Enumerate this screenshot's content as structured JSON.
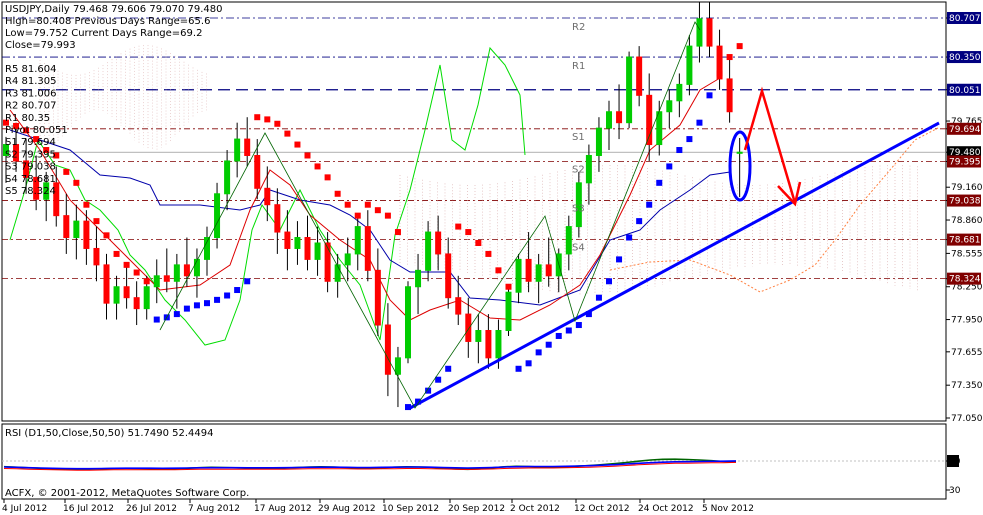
{
  "header": {
    "symbol": "USDJPY,Daily",
    "ohlc": "79.468 79.606 79.070 79.480",
    "lines": [
      "High=80.408   Previous Days Range=65.6",
      "Low=79.752   Current Days Range=69.2",
      "Close=79.993"
    ]
  },
  "pivot_list": [
    "R5 81.604",
    "R4 81.305",
    "R3 81.006",
    "R2 80.707",
    "R1 80.35",
    "Pivot 80.051",
    "S1 79.694",
    "S2 79.395",
    "S3 79.038",
    "S4 78.681",
    "S5 78.324"
  ],
  "level_tags": [
    "R2",
    "R1",
    "S1",
    "S2",
    "S3",
    "S4"
  ],
  "rsi_title": "RSI (D1,50,Close,50,50) 51.7490 52.4494",
  "copyright": "ACFX, © 2001-2012, MetaQuotes Software Corp.",
  "colors": {
    "bull": "#00cc00",
    "bear": "#ff0000",
    "psar": "#0000ff",
    "pivot_line": "#000080",
    "level_line": "#800000",
    "trend": "#0000ff",
    "ichimoku_span": "#ff8040",
    "kumo": "#d8a8a8",
    "green_line": "#00dd00",
    "rsi": "#006400",
    "rsi_ma": "#0000ff",
    "rsi_red": "#ff0000"
  },
  "chart_data": [
    {
      "type": "candlestick",
      "title": "USDJPY,Daily",
      "x_ticks": [
        "4 Jul 2012",
        "16 Jul 2012",
        "26 Jul 2012",
        "7 Aug 2012",
        "17 Aug 2012",
        "29 Aug 2012",
        "10 Sep 2012",
        "20 Sep 2012",
        "2 Oct 2012",
        "12 Oct 2012",
        "24 Oct 2012",
        "5 Nov 2012"
      ],
      "y_ticks": [
        80.707,
        80.35,
        80.051,
        79.765,
        79.694,
        79.48,
        79.395,
        79.16,
        79.038,
        78.86,
        78.681,
        78.555,
        78.324,
        78.25,
        77.95,
        77.655,
        77.35,
        77.05
      ],
      "ylim": [
        77.05,
        80.9
      ],
      "price_labels": [
        {
          "text": "80.707",
          "color": "#000080"
        },
        {
          "text": "80.350",
          "color": "#000080"
        },
        {
          "text": "80.051",
          "color": "#000080"
        },
        {
          "text": "79.694",
          "color": "#800000"
        },
        {
          "text": "79.480",
          "color": "#000000"
        },
        {
          "text": "79.395",
          "color": "#800000"
        },
        {
          "text": "79.038",
          "color": "#800000"
        },
        {
          "text": "78.681",
          "color": "#800000"
        },
        {
          "text": "78.324",
          "color": "#800000"
        }
      ],
      "pivot_levels": [
        {
          "name": "R2",
          "value": 80.707
        },
        {
          "name": "R1",
          "value": 80.35
        },
        {
          "name": "Pivot",
          "value": 80.051
        },
        {
          "name": "S1",
          "value": 79.694
        },
        {
          "name": "S2",
          "value": 79.395
        },
        {
          "name": "S3",
          "value": 79.038
        },
        {
          "name": "S4",
          "value": 78.681
        },
        {
          "name": "S5",
          "value": 78.324
        }
      ],
      "candles": [
        [
          79.45,
          79.62,
          79.2,
          79.55
        ],
        [
          79.55,
          79.75,
          79.3,
          79.4
        ],
        [
          79.4,
          79.6,
          79.1,
          79.25
        ],
        [
          79.25,
          79.45,
          78.95,
          79.05
        ],
        [
          79.05,
          79.3,
          78.85,
          79.2
        ],
        [
          79.2,
          79.35,
          78.8,
          78.9
        ],
        [
          78.9,
          79.1,
          78.55,
          78.7
        ],
        [
          78.7,
          79.0,
          78.5,
          78.85
        ],
        [
          78.85,
          78.95,
          78.45,
          78.6
        ],
        [
          78.6,
          78.8,
          78.3,
          78.45
        ],
        [
          78.45,
          78.55,
          77.95,
          78.1
        ],
        [
          78.1,
          78.35,
          77.95,
          78.25
        ],
        [
          78.25,
          78.45,
          78.05,
          78.15
        ],
        [
          78.15,
          78.3,
          77.9,
          78.05
        ],
        [
          78.05,
          78.35,
          77.95,
          78.25
        ],
        [
          78.25,
          78.5,
          78.1,
          78.35
        ],
        [
          78.35,
          78.6,
          78.2,
          78.3
        ],
        [
          78.3,
          78.55,
          78.05,
          78.45
        ],
        [
          78.45,
          78.7,
          78.25,
          78.35
        ],
        [
          78.35,
          78.6,
          78.15,
          78.5
        ],
        [
          78.5,
          78.8,
          78.35,
          78.7
        ],
        [
          78.7,
          79.2,
          78.6,
          79.1
        ],
        [
          79.1,
          79.5,
          78.95,
          79.4
        ],
        [
          79.4,
          79.75,
          79.25,
          79.6
        ],
        [
          79.6,
          79.8,
          79.35,
          79.45
        ],
        [
          79.45,
          79.6,
          79.05,
          79.15
        ],
        [
          79.15,
          79.35,
          78.85,
          79.0
        ],
        [
          79.0,
          79.15,
          78.55,
          78.75
        ],
        [
          78.75,
          78.95,
          78.4,
          78.6
        ],
        [
          78.6,
          78.85,
          78.45,
          78.7
        ],
        [
          78.7,
          78.9,
          78.4,
          78.5
        ],
        [
          78.5,
          78.8,
          78.35,
          78.65
        ],
        [
          78.65,
          78.75,
          78.2,
          78.3
        ],
        [
          78.3,
          78.55,
          78.15,
          78.45
        ],
        [
          78.45,
          78.7,
          78.3,
          78.55
        ],
        [
          78.55,
          78.9,
          78.4,
          78.8
        ],
        [
          78.8,
          78.95,
          78.3,
          78.4
        ],
        [
          78.4,
          78.6,
          77.8,
          77.9
        ],
        [
          77.9,
          78.1,
          77.25,
          77.45
        ],
        [
          77.45,
          77.7,
          77.15,
          77.6
        ],
        [
          77.6,
          78.3,
          77.55,
          78.25
        ],
        [
          78.25,
          78.55,
          78.0,
          78.4
        ],
        [
          78.4,
          78.85,
          78.3,
          78.75
        ],
        [
          78.75,
          78.9,
          78.4,
          78.55
        ],
        [
          78.55,
          78.7,
          78.05,
          78.15
        ],
        [
          78.15,
          78.35,
          77.9,
          78.0
        ],
        [
          78.0,
          78.15,
          77.6,
          77.75
        ],
        [
          77.75,
          78.0,
          77.55,
          77.85
        ],
        [
          77.85,
          78.0,
          77.5,
          77.6
        ],
        [
          77.6,
          77.95,
          77.5,
          77.85
        ],
        [
          77.85,
          78.25,
          77.8,
          78.2
        ],
        [
          78.2,
          78.55,
          78.1,
          78.5
        ],
        [
          78.5,
          78.75,
          78.2,
          78.3
        ],
        [
          78.3,
          78.55,
          78.1,
          78.45
        ],
        [
          78.45,
          78.7,
          78.25,
          78.35
        ],
        [
          78.35,
          78.6,
          78.2,
          78.55
        ],
        [
          78.55,
          78.9,
          78.4,
          78.8
        ],
        [
          78.8,
          79.3,
          78.7,
          79.2
        ],
        [
          79.2,
          79.55,
          79.0,
          79.45
        ],
        [
          79.45,
          79.8,
          79.3,
          79.7
        ],
        [
          79.7,
          79.95,
          79.5,
          79.85
        ],
        [
          79.85,
          80.1,
          79.6,
          79.75
        ],
        [
          79.75,
          80.4,
          79.7,
          80.35
        ],
        [
          80.35,
          80.45,
          79.9,
          80.0
        ],
        [
          80.0,
          80.2,
          79.4,
          79.55
        ],
        [
          79.55,
          79.95,
          79.45,
          79.85
        ],
        [
          79.85,
          80.05,
          79.7,
          79.95
        ],
        [
          79.95,
          80.2,
          79.8,
          80.1
        ],
        [
          80.1,
          80.55,
          80.0,
          80.45
        ],
        [
          80.45,
          80.85,
          80.3,
          80.7
        ],
        [
          80.7,
          80.85,
          80.35,
          80.45
        ],
        [
          80.45,
          80.6,
          80.05,
          80.15
        ],
        [
          80.15,
          80.35,
          79.75,
          79.85
        ],
        [
          79.47,
          79.61,
          79.07,
          79.48
        ]
      ],
      "psar": [
        79.75,
        79.72,
        79.68,
        79.6,
        79.5,
        79.45,
        79.3,
        79.2,
        79.0,
        78.85,
        78.72,
        78.55,
        78.45,
        78.38,
        78.3,
        77.95,
        77.97,
        78.0,
        78.05,
        78.08,
        78.1,
        78.13,
        78.17,
        78.22,
        78.3,
        79.8,
        79.78,
        79.74,
        79.65,
        79.55,
        79.45,
        79.35,
        79.25,
        79.1,
        79.0,
        78.9,
        79.0,
        78.95,
        78.9,
        78.75,
        77.15,
        77.2,
        77.3,
        77.4,
        77.5,
        78.8,
        78.75,
        78.65,
        78.55,
        78.4,
        78.25,
        77.5,
        77.55,
        77.65,
        77.72,
        77.8,
        77.85,
        77.9,
        78.0,
        78.15,
        78.3,
        78.5,
        78.7,
        78.85,
        79.0,
        79.2,
        79.35,
        79.5,
        79.6,
        79.75,
        80.0,
        80.2,
        80.35,
        80.45
      ]
    },
    {
      "type": "line",
      "title": "RSI (D1,50,Close,50,50) 51.7490 52.4494",
      "y_ticks": [
        50,
        30
      ],
      "y_tick_labels": [
        "50",
        "30"
      ],
      "ylim": [
        30,
        70
      ],
      "series": [
        {
          "values": [
            49,
            48.7,
            48.3,
            48,
            47.8,
            47.5,
            47.4,
            47.5,
            47.7,
            47.9,
            48,
            47.9,
            47.8,
            47.7,
            47.8,
            48,
            48.4,
            48.6,
            48.5,
            48.3,
            48,
            47.8,
            47.8,
            48.1,
            48.5,
            48.8,
            48.9,
            48.8,
            48.5,
            48.2,
            48,
            48.3,
            48.7,
            48.9,
            48.8,
            48.6,
            48.1,
            47.6,
            47.4,
            47.7,
            48.3,
            48.9,
            49.2,
            49.1,
            48.8,
            48.6,
            48.9,
            49.3,
            49.7,
            50.2,
            50.8,
            51.5,
            52.3,
            53,
            53.4,
            53.5,
            53.3,
            53,
            52.6,
            52.1,
            51.8
          ]
        },
        {
          "values": [
            48.8,
            48.6,
            48.4,
            48.2,
            48,
            47.9,
            47.8,
            47.8,
            47.9,
            48,
            48.1,
            48.1,
            48.1,
            48,
            48.1,
            48.2,
            48.3,
            48.4,
            48.4,
            48.4,
            48.3,
            48.3,
            48.3,
            48.4,
            48.5,
            48.6,
            48.7,
            48.7,
            48.6,
            48.5,
            48.5,
            48.6,
            48.7,
            48.8,
            48.8,
            48.7,
            48.5,
            48.3,
            48.2,
            48.3,
            48.5,
            48.8,
            49,
            49.1,
            49.1,
            49.1,
            49.2,
            49.4,
            49.6,
            49.9,
            50.2,
            50.6,
            51,
            51.4,
            51.7,
            51.9,
            52,
            52.1,
            52.2,
            52.3,
            52.45
          ]
        }
      ]
    }
  ]
}
